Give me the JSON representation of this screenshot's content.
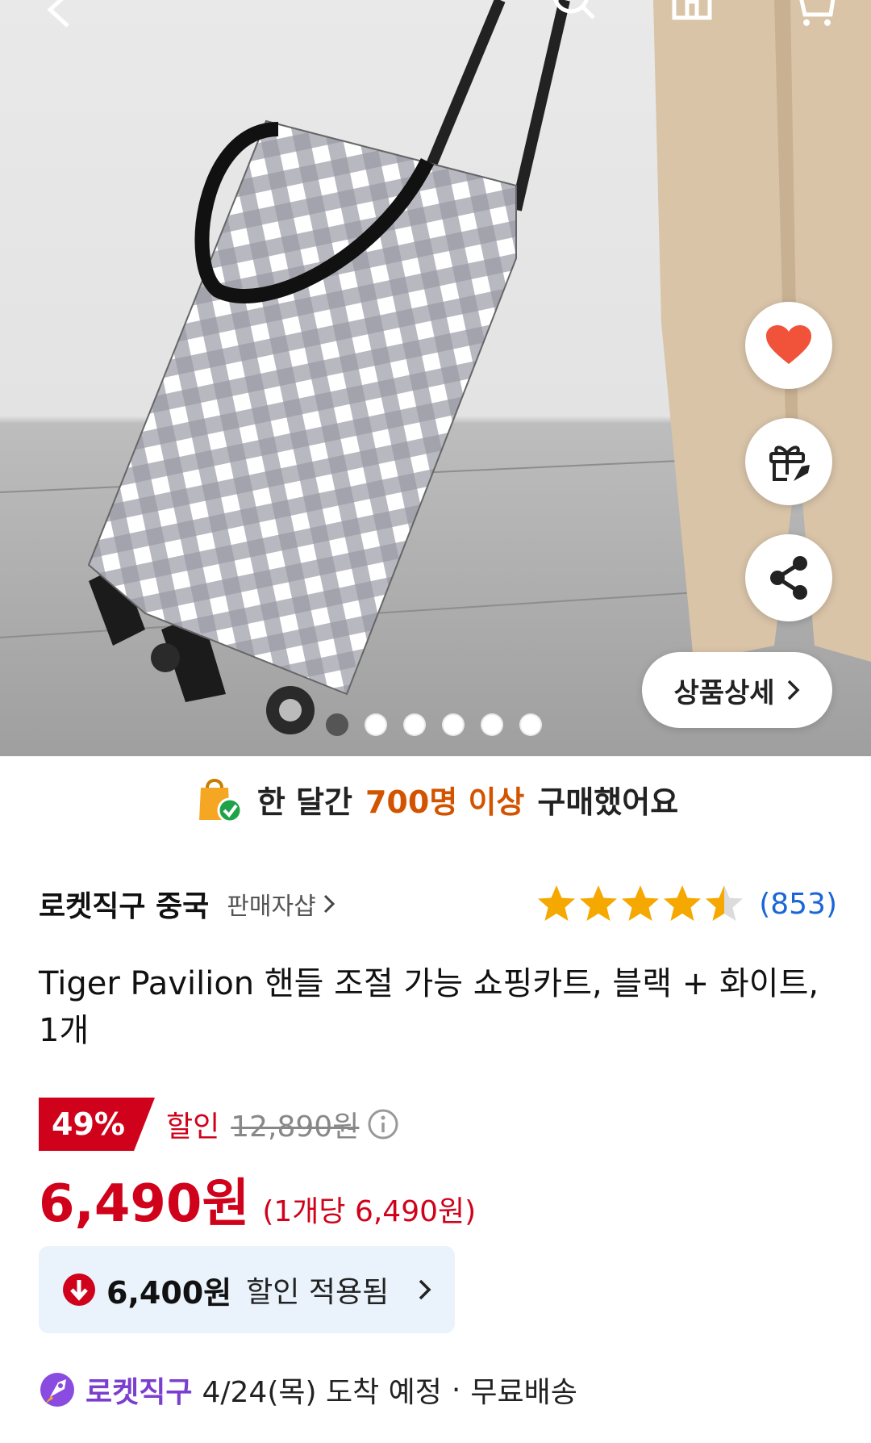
{
  "header": {
    "back_icon": "chevron-left-icon",
    "search_icon": "search-icon",
    "home_icon": "home-icon",
    "cart_icon": "cart-icon"
  },
  "gallery": {
    "image_alt": "체크무늬 쇼핑카트",
    "image_count": 6,
    "active_index": 0,
    "detail_button": "상품상세",
    "side_actions": [
      "heart-icon",
      "gift-rocket-icon",
      "share-icon"
    ],
    "heart_color": "#f0523a"
  },
  "banner": {
    "prefix": "한 달간",
    "highlight": "700명 이상",
    "suffix": "구매했어요",
    "highlight_color": "#d35400"
  },
  "seller": {
    "name": "로켓직구 중국",
    "shop_link": "판매자샵",
    "rating": 4.5,
    "review_count": "(853)"
  },
  "product": {
    "title": "Tiger Pavilion 핸들 조절 가능 쇼핑카트, 블랙 + 화이트, 1개"
  },
  "price": {
    "discount_rate": "49%",
    "discount_label": "할인",
    "original_price": "12,890원",
    "sale_price": "6,490원",
    "unit_price": "(1개당 6,490원)",
    "accent_color": "#d0021b"
  },
  "coupon": {
    "price": "6,400원",
    "label": "할인 적용됨"
  },
  "delivery": {
    "badge": "로켓직구",
    "date": "4/24(목) 도착 예정",
    "separator": "·",
    "shipping": "무료배송"
  }
}
